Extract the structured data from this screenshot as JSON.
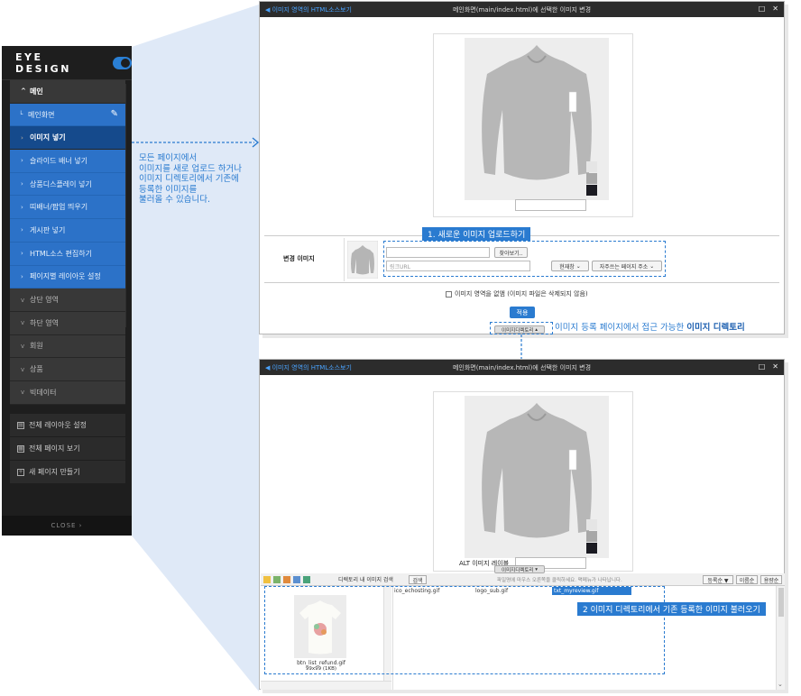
{
  "sidebar": {
    "logo": "EYE DESIGN",
    "section_main": "메인",
    "main_page": "메인화면",
    "items": [
      "이미지 넣기",
      "슬라이드 배너 넣기",
      "상품디스플레이 넣기",
      "띠배너/팝업 띄우기",
      "게시판 넣기",
      "HTML소스 편집하기",
      "페이지별 레이아웃 설정"
    ],
    "groups": [
      "상단 영역",
      "하단 영역",
      "회원",
      "상품",
      "빅데이터"
    ],
    "bottom": [
      "전체 레이아웃 설정",
      "전체 페이지 보기",
      "새 페이지 만들기"
    ],
    "close": "CLOSE"
  },
  "annotation": {
    "lines": [
      "모든 페이지에서",
      "이미지를 새로 업로드 하거나",
      "이미지 디렉토리에서 기존에",
      "등록한 이미지를",
      "불러올 수 있습니다."
    ]
  },
  "window1": {
    "title_left": "◀ 이미지 영역의 HTML소스보기",
    "title_center": "메인화면(main/index.html)에 선택한 이미지 변경",
    "label_change": "변경 이미지",
    "btn_browse": "찾아보기..",
    "link_placeholder": "링크URL",
    "select_window": "현재창",
    "select_pages": "자주쓰는 페이지 주소",
    "checkbox_label": "이미지 영역을 없앰 (이미지 파일은 삭제되지 않음)",
    "apply": "적용",
    "tab_dir": "이미지디렉토리",
    "callout1": "1. 새로운 이미지 업로드하기",
    "note_plain": "이미지 등록 페이지에서 접근 가능한 ",
    "note_bold": "이미지 디렉토리"
  },
  "window2": {
    "title_left": "◀ 이미지 영역의 HTML소스보기",
    "title_center": "메인화면(main/index.html)에 선택한 이미지 변경",
    "alt_label": "ALT 이미지 레이블",
    "tab_dir": "이미지디렉토리",
    "search_label": "디렉토리 내 이미지 검색",
    "search_btn": "검색",
    "hint": "파일명에 마우스 오른쪽을 클릭하세요. 펵메뉴가 나타납니다.",
    "sort1": "등록순 ▼",
    "sort2": "이름순",
    "sort3": "용량순",
    "files": [
      "ico_echosting.gif",
      "logo_sub.gif",
      "txt_myreview.gif"
    ],
    "thumb_name": "btn_list_refund.gif",
    "thumb_size": "99x99 (1KB)",
    "callout2": "2 이미지 디렉토리에서 기존 등록한 이미지 불러오기"
  },
  "colors": {
    "accent": "#2a7bd0",
    "sidebar_bg": "#1e1e1e"
  }
}
